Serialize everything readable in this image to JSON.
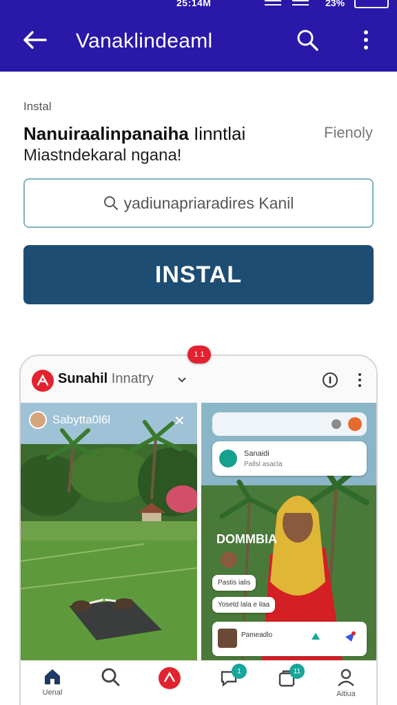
{
  "status_bar": {
    "time": "25:14M",
    "battery": "23%"
  },
  "app_bar": {
    "title": "Vanaklindeaml",
    "bg": "#2a18a8"
  },
  "listing": {
    "label": "Instal",
    "title_bold": "Nanuiraalinpanaiha",
    "title_rest": " Iinntlai",
    "subtitle": "Miastndekaral ngana!",
    "right_text": "Fienoly"
  },
  "search": {
    "placeholder": "yadiunapriaradires Kanil"
  },
  "install": {
    "label": "INSTAL",
    "color": "#1e4d73"
  },
  "preview": {
    "notif": "1 1",
    "brand_bold": "Sunahil",
    "brand_rest": " Innatry",
    "left_panel": {
      "story_name": "Sabytta0l6l"
    },
    "right_panel": {
      "msg_line1": "Sanaidi",
      "msg_line2": "Pallsl asacla",
      "overlay": "DOMMBIA",
      "bubble1": "Pastis ialis",
      "bubble2": "Yosetd lala e ilaa",
      "bubble3": "Pameadlo"
    },
    "nav": {
      "home": "Uenal",
      "profile": "Aitiua",
      "badge1": "1",
      "badge2": "11"
    }
  }
}
